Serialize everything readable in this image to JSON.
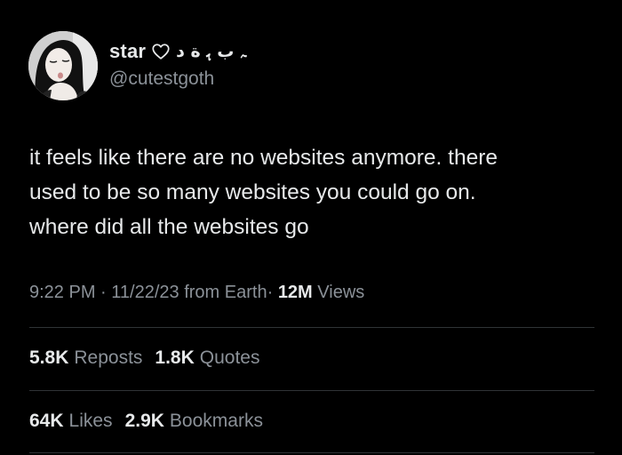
{
  "author": {
    "display_name": "star",
    "name_decoration": "ﮧ ب ﮨ ﺓ ﺩ",
    "handle": "@cutestgoth"
  },
  "tweet": {
    "text_lines": [
      "it feels like there are no websites anymore. there",
      "used to be so many websites you could go on.",
      "where did all the websites go"
    ]
  },
  "meta": {
    "time": "9:22 PM",
    "date": "11/22/23",
    "location": "from Earth",
    "separator": "·",
    "views_count": "12M",
    "views_label": "Views"
  },
  "stats": {
    "reposts_count": "5.8K",
    "reposts_label": "Reposts",
    "quotes_count": "1.8K",
    "quotes_label": "Quotes",
    "likes_count": "64K",
    "likes_label": "Likes",
    "bookmarks_count": "2.9K",
    "bookmarks_label": "Bookmarks"
  },
  "icons": {
    "heart": "heart-outline-icon"
  },
  "colors": {
    "background": "#000000",
    "primary_text": "#e7e9ea",
    "secondary_text": "#8b9198",
    "divider": "#2f3336"
  }
}
